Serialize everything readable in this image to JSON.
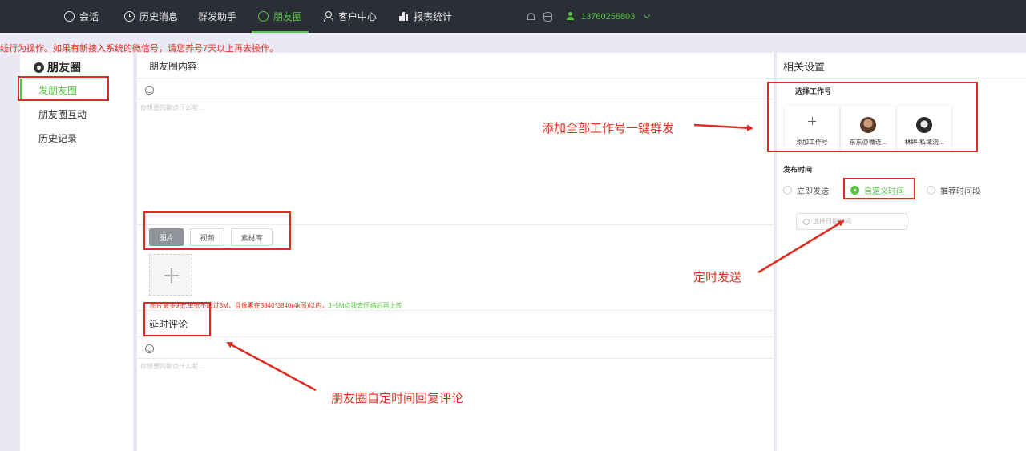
{
  "nav": {
    "items": [
      {
        "label": "会话",
        "icon": "chat-icon"
      },
      {
        "label": "历史消息",
        "icon": "clock-icon"
      },
      {
        "label": "群发助手",
        "icon": ""
      },
      {
        "label": "朋友圈",
        "icon": "moments-icon",
        "active": true
      },
      {
        "label": "客户中心",
        "icon": "person-icon"
      },
      {
        "label": "报表统计",
        "icon": "bar-chart-icon"
      }
    ],
    "phone": "13760256803",
    "accent_color": "#56c742",
    "bg_color": "#2b2e36"
  },
  "notice": "线行为操作。如果有新接入系统的微信号，请您养号7天以上再去操作。",
  "sidebar": {
    "title": "朋友圈",
    "items": [
      {
        "label": "发朋友圈",
        "active": true
      },
      {
        "label": "朋友圈互动"
      },
      {
        "label": "历史记录"
      }
    ]
  },
  "main": {
    "content_title": "朋友圈内容",
    "content_placeholder": "你想要的聊点什么呢 ...",
    "media_tabs": [
      "图片",
      "视频",
      "素材库"
    ],
    "upload_hint": "图片最多9张,单张不超过3M，且像素在3840*3840(4k图)以内，",
    "upload_hint_link": "3~5M点我去压缩后再上传",
    "delay_title": "延时评论",
    "comment_placeholder": "你想要的聊点什么呢 ..."
  },
  "settings": {
    "title": "相关设置",
    "accounts_label": "选择工作号",
    "accounts": [
      {
        "name": "添加工作号",
        "type": "add"
      },
      {
        "name": "东东@微连...",
        "type": "avatar"
      },
      {
        "name": "林婷-私域流...",
        "type": "avatar"
      }
    ],
    "time_label": "发布时间",
    "time_options": [
      {
        "label": "立即发送",
        "selected": false
      },
      {
        "label": "自定义时间",
        "selected": true
      },
      {
        "label": "推荐时间段",
        "selected": false
      }
    ],
    "time_placeholder": "选择日期时间"
  },
  "annotations": {
    "add_all": "添加全部工作号一键群发",
    "scheduled": "定时发送",
    "delayed_comment": "朋友圈自定时间回复评论",
    "color": "#e02b20"
  }
}
